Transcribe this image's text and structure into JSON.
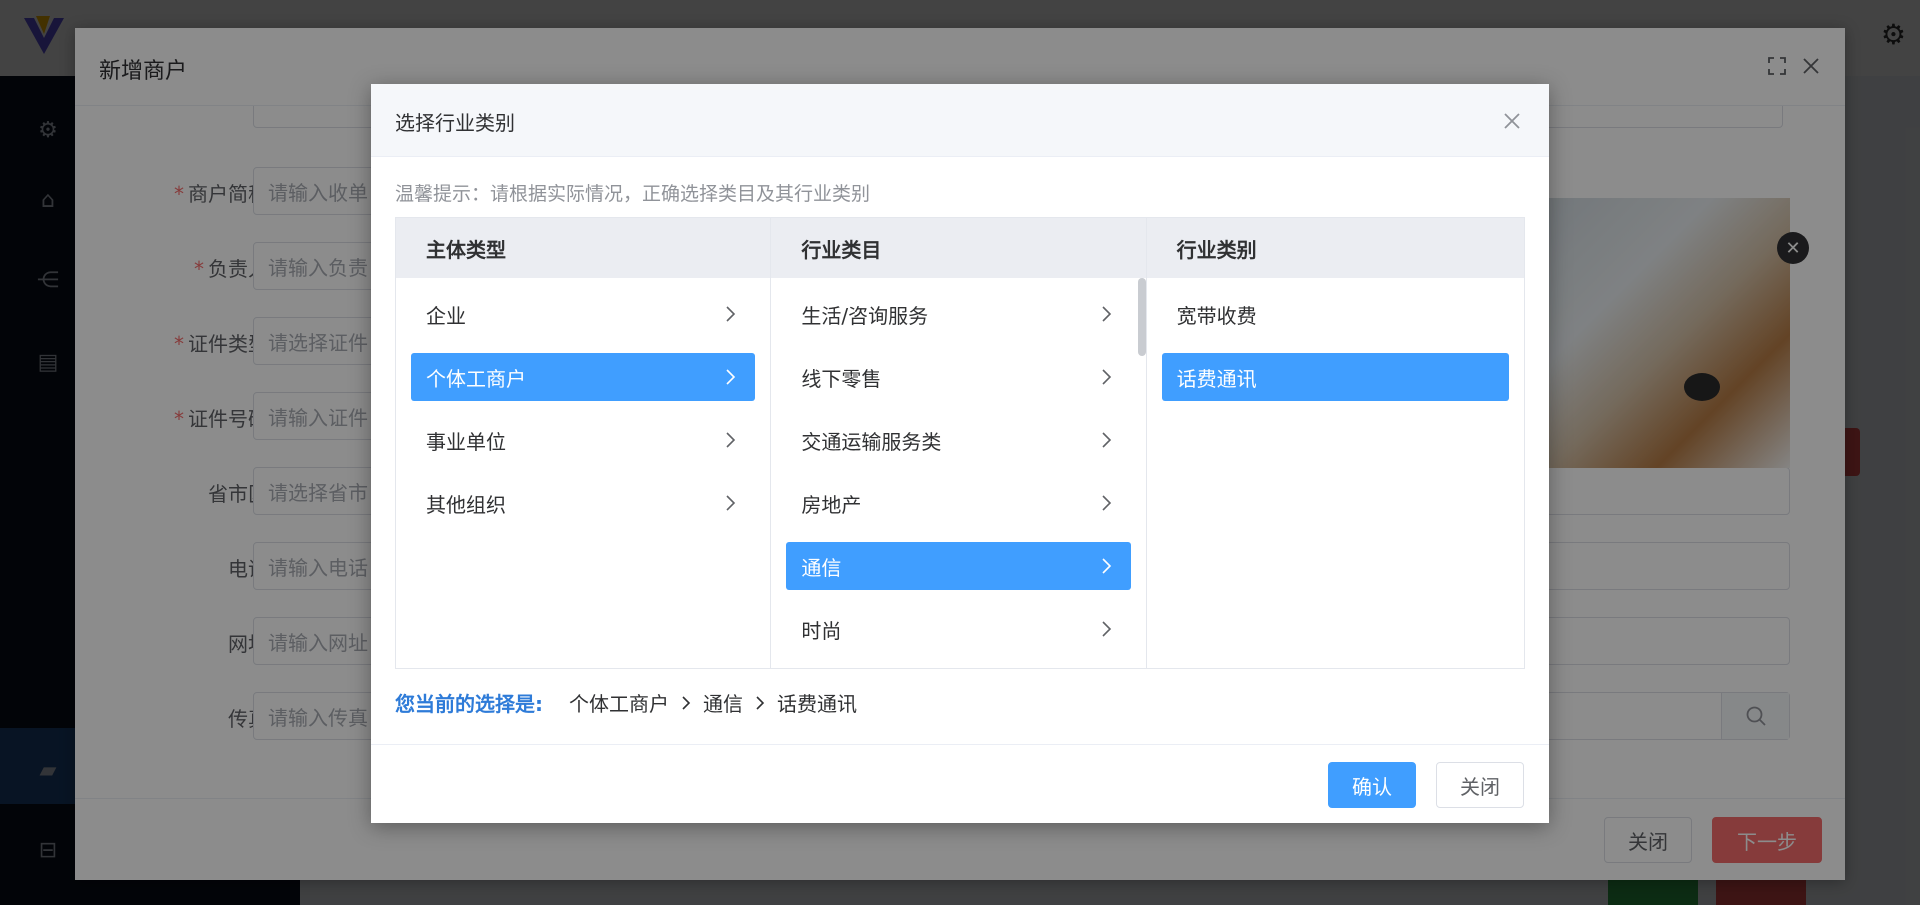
{
  "merchant_dialog": {
    "title": "新增商户",
    "form": [
      {
        "label": "商户简称",
        "required": true,
        "placeholder": "请输入收单"
      },
      {
        "label": "负责人",
        "required": true,
        "placeholder": "请输入负责"
      },
      {
        "label": "证件类型",
        "required": true,
        "placeholder": "请选择证件"
      },
      {
        "label": "证件号码",
        "required": true,
        "placeholder": "请输入证件"
      },
      {
        "label": "省市区",
        "required": false,
        "placeholder": "请选择省市"
      },
      {
        "label": "电话",
        "required": false,
        "placeholder": "请输入电话"
      },
      {
        "label": "网址",
        "required": false,
        "placeholder": "请输入网址"
      },
      {
        "label": "传真",
        "required": false,
        "placeholder": "请输入传真"
      }
    ],
    "footer": {
      "close_label": "关闭",
      "next_label": "下一步"
    }
  },
  "industry_dialog": {
    "title": "选择行业类别",
    "tip": "温馨提示：请根据实际情况，正确选择类目及其行业类别",
    "columns": [
      {
        "header": "主体类型",
        "items": [
          {
            "label": "企业",
            "active": false,
            "has_children": true
          },
          {
            "label": "个体工商户",
            "active": true,
            "has_children": true
          },
          {
            "label": "事业单位",
            "active": false,
            "has_children": true
          },
          {
            "label": "其他组织",
            "active": false,
            "has_children": true
          }
        ]
      },
      {
        "header": "行业类目",
        "items": [
          {
            "label": "生活/咨询服务",
            "active": false,
            "has_children": true
          },
          {
            "label": "线下零售",
            "active": false,
            "has_children": true
          },
          {
            "label": "交通运输服务类",
            "active": false,
            "has_children": true
          },
          {
            "label": "房地产",
            "active": false,
            "has_children": true
          },
          {
            "label": "通信",
            "active": true,
            "has_children": true
          },
          {
            "label": "时尚",
            "active": false,
            "has_children": true
          }
        ]
      },
      {
        "header": "行业类别",
        "items": [
          {
            "label": "宽带收费",
            "active": false,
            "has_children": false
          },
          {
            "label": "话费通讯",
            "active": true,
            "has_children": false
          }
        ]
      }
    ],
    "current_selection": {
      "label": "您当前的选择是:",
      "path": [
        "个体工商户",
        "通信",
        "话费通讯"
      ]
    },
    "footer": {
      "confirm_label": "确认",
      "close_label": "关闭"
    }
  },
  "colors": {
    "primary": "#409eff",
    "danger": "#f56c6c",
    "required": "#f56c6c",
    "selection_label": "#2e7bd8"
  }
}
